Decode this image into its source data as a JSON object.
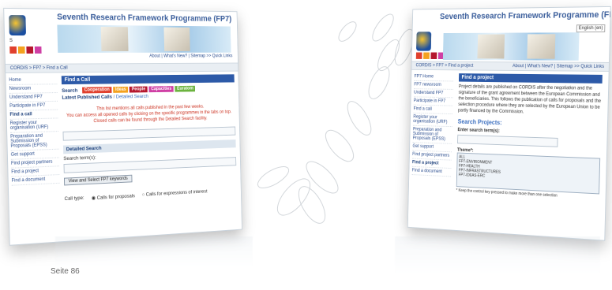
{
  "left": {
    "title": "Seventh Research Framework Programme (FP7)",
    "logo_text": "S",
    "top_links": "About | What's New? | Sitemap  >> Quick Links",
    "breadcrumb": "CORDIS > FP7 > Find a Call",
    "sidebar": [
      "Home",
      "Newsroom",
      "Understand FP7",
      "Participate in FP7",
      "Find a call",
      "Register your organisation (URF)",
      "Preparation and Submission of Proposals (EPSS)",
      "Get support",
      "Find project partners",
      "Find a project",
      "Find a document"
    ],
    "section_head": "Find a Call",
    "tabs": [
      {
        "label": "Search",
        "color": ""
      },
      {
        "label": "Cooperation",
        "color": "#e0402d"
      },
      {
        "label": "Ideas",
        "color": "#f4a21f"
      },
      {
        "label": "People",
        "color": "#b5172e"
      },
      {
        "label": "Capacities",
        "color": "#cf3fa4"
      },
      {
        "label": "Euratom",
        "color": "#6cb33f"
      }
    ],
    "latest_calls": "Latest Published Calls",
    "detailed_link": "Detailed Search",
    "note_lines": [
      "This list mentions all calls published in the past few weeks.",
      "You can access all opened calls by clicking on the specific programmes in the tabs on top.",
      "Closed calls can be found through the Detailed Search facility."
    ],
    "detailed_search": "Detailed Search",
    "search_terms": "Search term(s):",
    "view_button": "View and Select FP7 keywords",
    "call_type": "Call type:",
    "call_opt1": "Calls for proposals",
    "call_opt2": "Calls for expressions of interest"
  },
  "right": {
    "title": "Seventh Research Framework Programme (FP7)",
    "lang": "English (en)",
    "top_links": "About | What's New? | Sitemap  >> Quick Links",
    "breadcrumb": "CORDIS > FP7 > Find a project",
    "sidebar": [
      "FP7 Home",
      "FP7 newsroom",
      "Understand FP7",
      "Participate in FP7",
      "Find a call",
      "Register your organisation (URF)",
      "Preparation and Submission of Proposals (EPSS)",
      "Get support",
      "Find project partners",
      "Find a project",
      "Find a document"
    ],
    "section_head": "Find a project",
    "intro": "Project details are published on CORDIS after the negotiation and the signature of the grant agreement between the European Commission and the beneficiaries. This follows the publication of calls for proposals and the selection procedure where they are selected by the European Union to be partly financed by the Commission.",
    "search_projects": "Search Projects:",
    "enter_terms": "Enter search term(s):",
    "theme": "Theme*:",
    "themes": [
      "ALL",
      "FP7-ENVIRONMENT",
      "FP7-HEALTH",
      "FP7-INFRASTRUCTURES",
      "FP7-IDEAS-ERC"
    ],
    "footnote": "* Keep the control key pressed to make more than one selection"
  },
  "page_number": "Seite 86",
  "colors": {
    "brand_blue": "#2d5aa8",
    "link": "#2a4d8f",
    "note_red": "#cc3322"
  }
}
